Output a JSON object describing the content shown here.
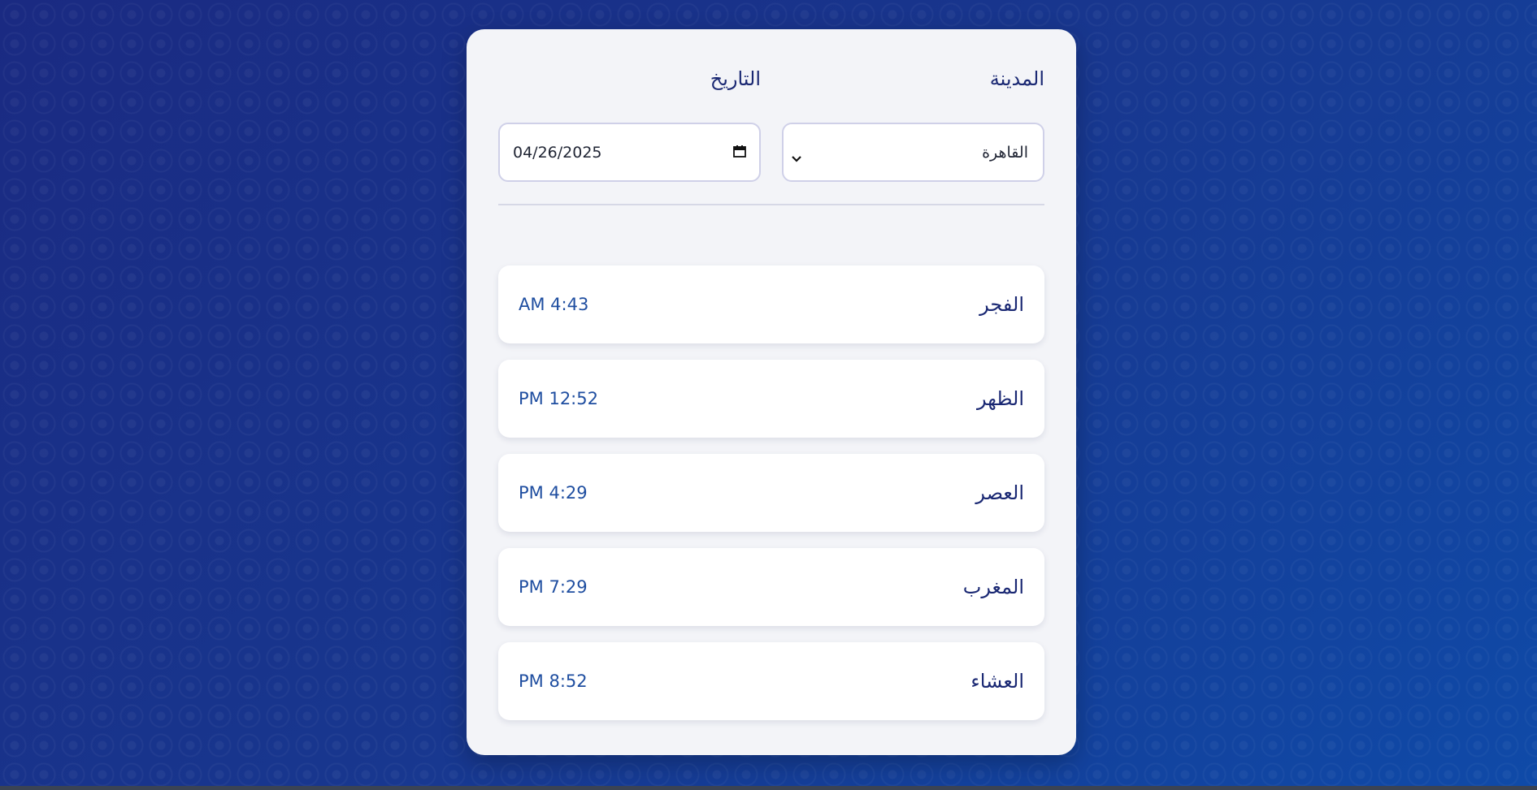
{
  "form": {
    "city_label": "المدينة",
    "city_value": "القاهرة",
    "date_label": "التاريخ",
    "date_value": "04/26/2025"
  },
  "prayers": [
    {
      "name": "الفجر",
      "time": "AM 4:43"
    },
    {
      "name": "الظهر",
      "time": "PM 12:52"
    },
    {
      "name": "العصر",
      "time": "PM 4:29"
    },
    {
      "name": "المغرب",
      "time": "PM 7:29"
    },
    {
      "name": "العشاء",
      "time": "PM 8:52"
    }
  ],
  "colors": {
    "background": "#17318a",
    "card": "#f3f4f8",
    "label_text": "#1a2873",
    "time_text": "#1f4ea0"
  },
  "icons": {
    "select_arrow": "chevron-down-icon",
    "date_picker": "calendar-icon"
  }
}
